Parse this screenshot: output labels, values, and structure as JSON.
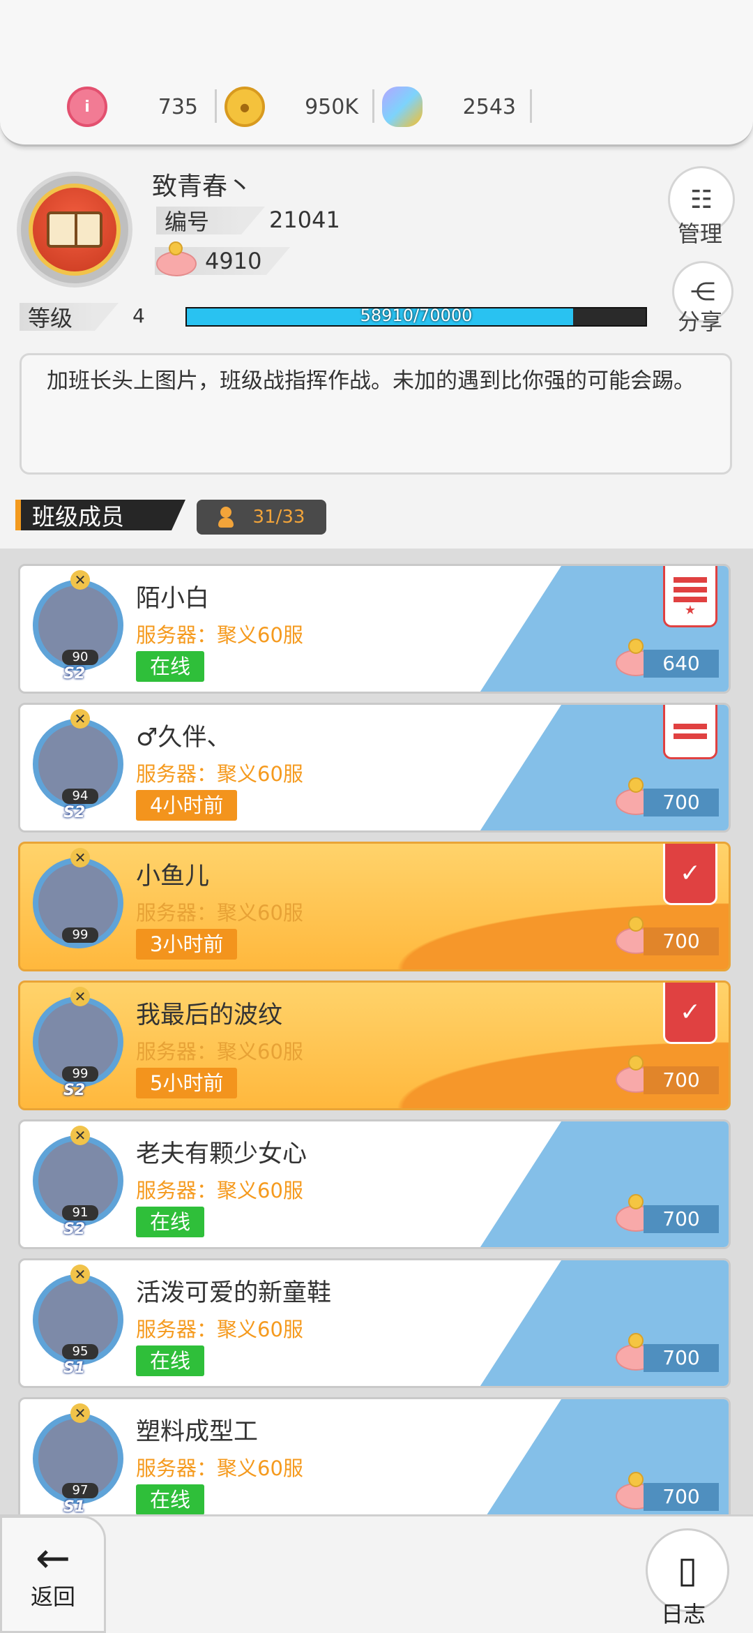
{
  "resources": [
    {
      "icon": "ruby-coin-icon",
      "value": "735",
      "color": "#e94b6f"
    },
    {
      "icon": "gold-coin-icon",
      "value": "950K",
      "color": "#f0b429"
    },
    {
      "icon": "crystal-pacifier-icon",
      "value": "2543",
      "color": "#a78bfa"
    }
  ],
  "class": {
    "name": "致青春丶",
    "id_label": "编号",
    "id_value": "21041",
    "piggy_value": "4910",
    "level_label": "等级",
    "level_value": "4",
    "exp_text": "58910/70000",
    "exp_fraction": 0.842
  },
  "side": {
    "manage": "管理",
    "share": "分享"
  },
  "notice": "加班长头上图片，班级战指挥作战。未加的遇到比你强的可能会踢。",
  "members": {
    "title": "班级成员",
    "count": "31/33",
    "list": [
      {
        "name": "陌小白",
        "server": "服务器：聚义60服",
        "status": "在线",
        "state": "online",
        "level": "90",
        "season": "S2",
        "score": "640",
        "rank": "monitor",
        "style": "normal"
      },
      {
        "name": "♂久伴、",
        "server": "服务器：聚义60服",
        "status": "4小时前",
        "state": "away",
        "level": "94",
        "season": "S2",
        "score": "700",
        "rank": "vice",
        "style": "normal"
      },
      {
        "name": "小鱼儿",
        "server": "服务器：聚义60服",
        "status": "3小时前",
        "state": "away",
        "level": "99",
        "season": "",
        "score": "700",
        "rank": "elite",
        "style": "gold"
      },
      {
        "name": "我最后的波纹",
        "server": "服务器：聚义60服",
        "status": "5小时前",
        "state": "away",
        "level": "99",
        "season": "S2",
        "score": "700",
        "rank": "elite",
        "style": "gold"
      },
      {
        "name": "老夫有颗少女心",
        "server": "服务器：聚义60服",
        "status": "在线",
        "state": "online",
        "level": "91",
        "season": "S2",
        "score": "700",
        "rank": "",
        "style": "normal"
      },
      {
        "name": "活泼可爱的新童鞋",
        "server": "服务器：聚义60服",
        "status": "在线",
        "state": "online",
        "level": "95",
        "season": "S1",
        "score": "700",
        "rank": "",
        "style": "normal"
      },
      {
        "name": "塑料成型工",
        "server": "服务器：聚义60服",
        "status": "在线",
        "state": "online",
        "level": "97",
        "season": "S1",
        "score": "700",
        "rank": "",
        "style": "normal"
      }
    ]
  },
  "bottom": {
    "back": "返回",
    "log": "日志"
  }
}
